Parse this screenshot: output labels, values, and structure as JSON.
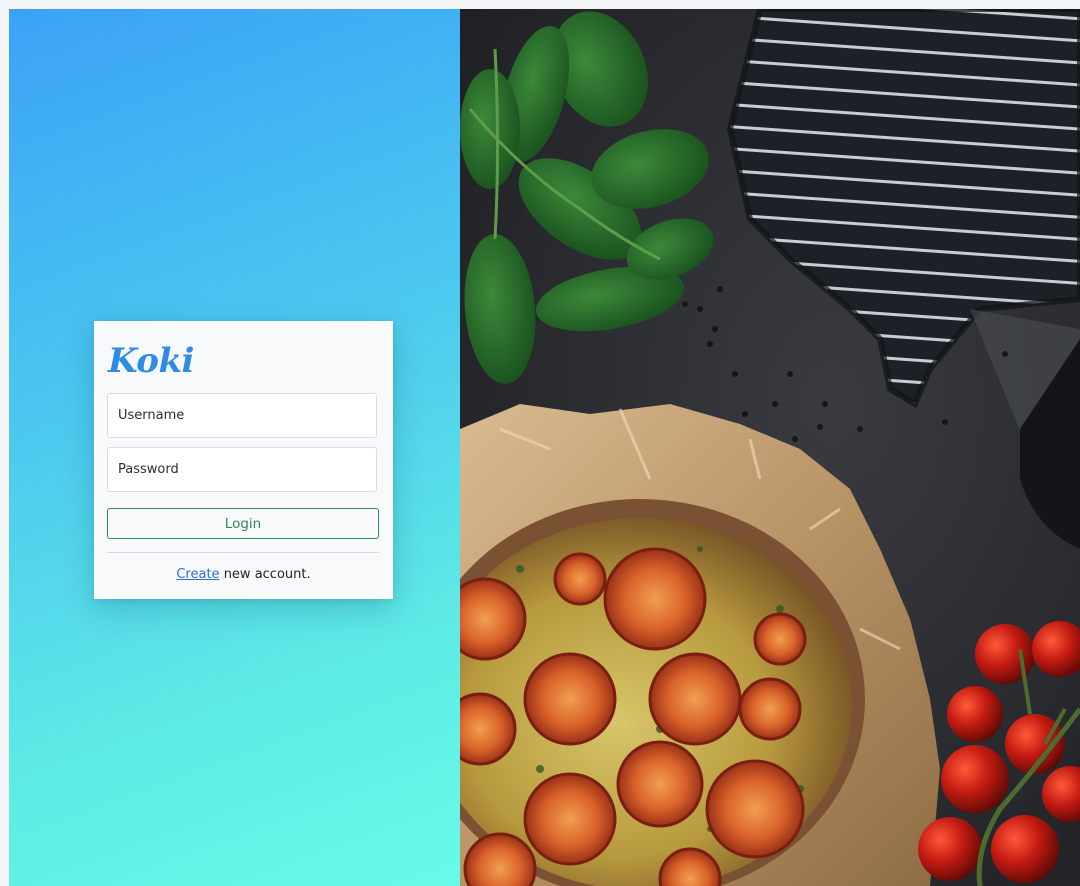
{
  "brand": {
    "name": "Koki",
    "color": "#2e8be6"
  },
  "login_form": {
    "username_placeholder": "Username",
    "password_placeholder": "Password",
    "login_label": "Login",
    "create_link": "Create",
    "create_suffix": " new account."
  },
  "colors": {
    "gradient_top": "#3aa2f6",
    "gradient_bottom": "#67fbe7",
    "button_accent": "#2f8a5a",
    "link": "#2e6fd0"
  },
  "hero_image": {
    "subject": "food photo: tomato quiche on parchment, spinach leaves, dark oven mitt, cherry tomatoes on dark slate"
  }
}
